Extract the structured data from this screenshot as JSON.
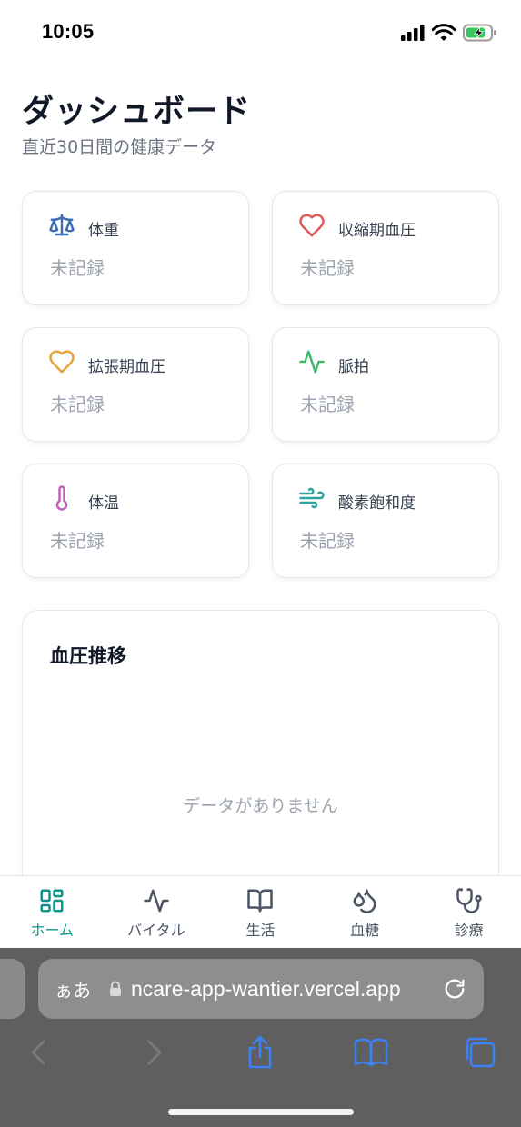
{
  "status_bar": {
    "time": "10:05"
  },
  "header": {
    "title": "ダッシュボード",
    "subtitle": "直近30日間の健康データ"
  },
  "metrics": [
    {
      "label": "体重",
      "value": "未記録",
      "icon": "scale-icon",
      "color": "#3b6fb5"
    },
    {
      "label": "収縮期血圧",
      "value": "未記録",
      "icon": "heart-icon",
      "color": "#e05a5a"
    },
    {
      "label": "拡張期血圧",
      "value": "未記録",
      "icon": "heart-icon",
      "color": "#e8a23a"
    },
    {
      "label": "脈拍",
      "value": "未記録",
      "icon": "activity-icon",
      "color": "#3fb86a"
    },
    {
      "label": "体温",
      "value": "未記録",
      "icon": "thermometer-icon",
      "color": "#c062b8"
    },
    {
      "label": "酸素飽和度",
      "value": "未記録",
      "icon": "wind-icon",
      "color": "#2aa6a0"
    }
  ],
  "chart_card": {
    "title": "血圧推移",
    "empty_text": "データがありません"
  },
  "bottom_nav": {
    "items": [
      {
        "label": "ホーム",
        "icon": "grid-icon",
        "active": true
      },
      {
        "label": "バイタル",
        "icon": "activity-icon",
        "active": false
      },
      {
        "label": "生活",
        "icon": "book-icon",
        "active": false
      },
      {
        "label": "血糖",
        "icon": "droplets-icon",
        "active": false
      },
      {
        "label": "診療",
        "icon": "stethoscope-icon",
        "active": false
      }
    ],
    "active_color": "#0f9488"
  },
  "browser": {
    "aa_label": "ぁあ",
    "url": "ncare-app-wantier.vercel.app"
  }
}
